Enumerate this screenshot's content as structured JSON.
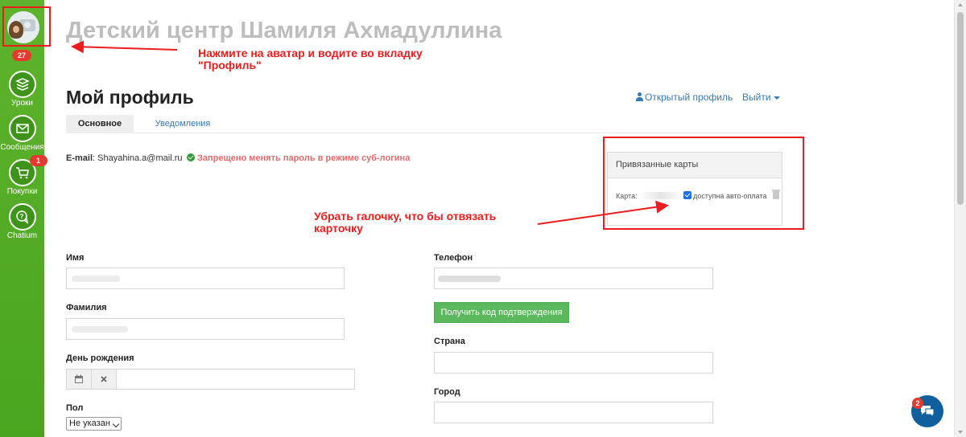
{
  "sidebar": {
    "notifications_count": "27",
    "items": [
      {
        "label": "Уроки",
        "icon": "lessons-icon"
      },
      {
        "label": "Сообщения",
        "icon": "envelope-icon"
      },
      {
        "label": "Покупки",
        "icon": "cart-icon",
        "badge": "1"
      },
      {
        "label": "Chatium",
        "icon": "chatium-icon"
      }
    ],
    "color": "#4ba822"
  },
  "header": {
    "site_title": "Детский центр Шамиля Ахмадуллина"
  },
  "annotations": {
    "avatar_hint": "Нажмите на аватар и водите во вкладку \"Профиль\"",
    "card_hint": "Убрать галочку, что бы отвязать карточку",
    "color": "#ee1c1c"
  },
  "profile": {
    "title": "Мой профиль",
    "open_profile_link": "Открытый профиль",
    "logout_link": "Выйти",
    "tabs": [
      {
        "label": "Основное",
        "active": true
      },
      {
        "label": "Уведомления",
        "active": false
      }
    ],
    "email_label": "E-mail",
    "email_value": "Shayahina.a@mail.ru",
    "password_notice": "Запрещено менять пароль в режиме суб-логина"
  },
  "cards": {
    "header": "Привязанные карты",
    "card_label": "Карта:",
    "autopay_label": "доступна авто-оплата",
    "autopay_checked": true
  },
  "form": {
    "first_name_label": "Имя",
    "last_name_label": "Фамилия",
    "birthday_label": "День рождения",
    "gender_label": "Пол",
    "gender_value": "Не указан",
    "phone_label": "Телефон",
    "get_code_button": "Получить код подтверждения",
    "country_label": "Страна",
    "city_label": "Город"
  },
  "chat_widget": {
    "badge": "2",
    "color": "#0e5f9c"
  }
}
